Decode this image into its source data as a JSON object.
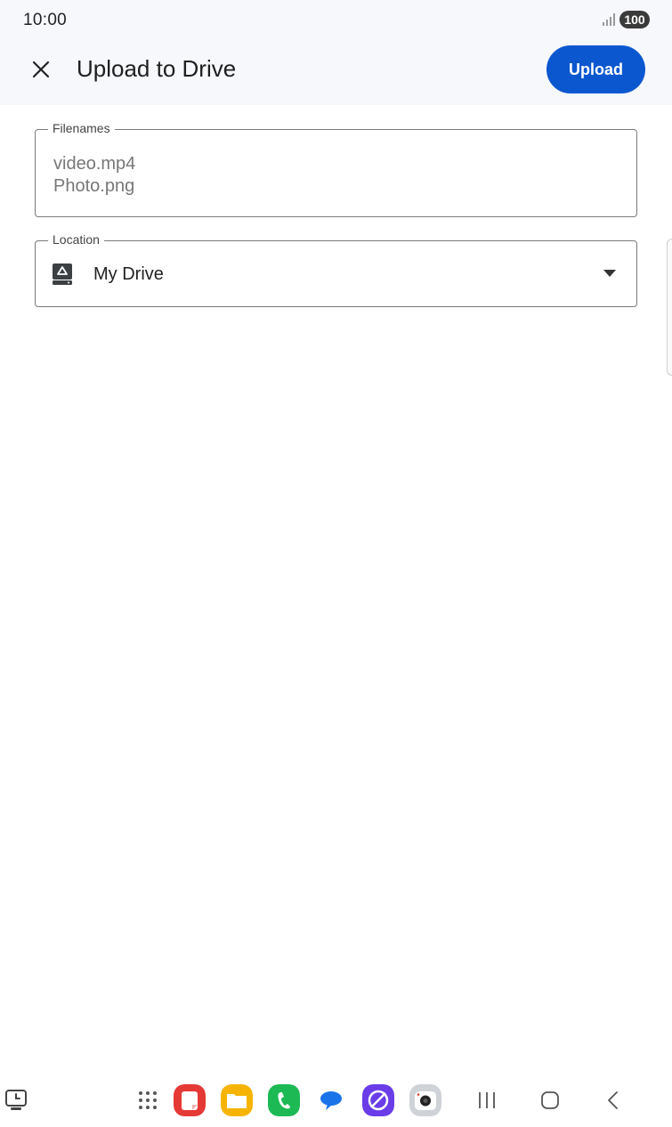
{
  "status_bar": {
    "time": "10:00",
    "battery": "100",
    "icons": [
      "signal-icon",
      "battery-icon"
    ]
  },
  "app_bar": {
    "close_icon": "close-icon",
    "title": "Upload to Drive",
    "upload_label": "Upload"
  },
  "form": {
    "filenames": {
      "label": "Filenames",
      "values": [
        "video.mp4",
        "Photo.png"
      ]
    },
    "location": {
      "label": "Location",
      "value": "My Drive",
      "icon": "drive-icon",
      "dropdown_icon": "dropdown-arrow-icon"
    }
  },
  "taskbar": {
    "items": [
      {
        "name": "screen-time-icon"
      },
      {
        "name": "app-drawer-icon"
      },
      {
        "name": "notes-app-icon",
        "color": "#e53935"
      },
      {
        "name": "files-app-icon",
        "color": "#f6b400"
      },
      {
        "name": "phone-app-icon",
        "color": "#1db954"
      },
      {
        "name": "messages-app-icon",
        "color": "#1a73e8"
      },
      {
        "name": "internet-app-icon",
        "color": "#6a3de8"
      },
      {
        "name": "camera-app-icon",
        "color": "#cfd3d8"
      },
      {
        "name": "recents-nav-icon"
      },
      {
        "name": "home-nav-icon"
      },
      {
        "name": "back-nav-icon"
      }
    ]
  },
  "colors": {
    "accent": "#0b57d0",
    "top_bar_bg": "#f6f8fc",
    "field_border": "#7a7a7a"
  }
}
